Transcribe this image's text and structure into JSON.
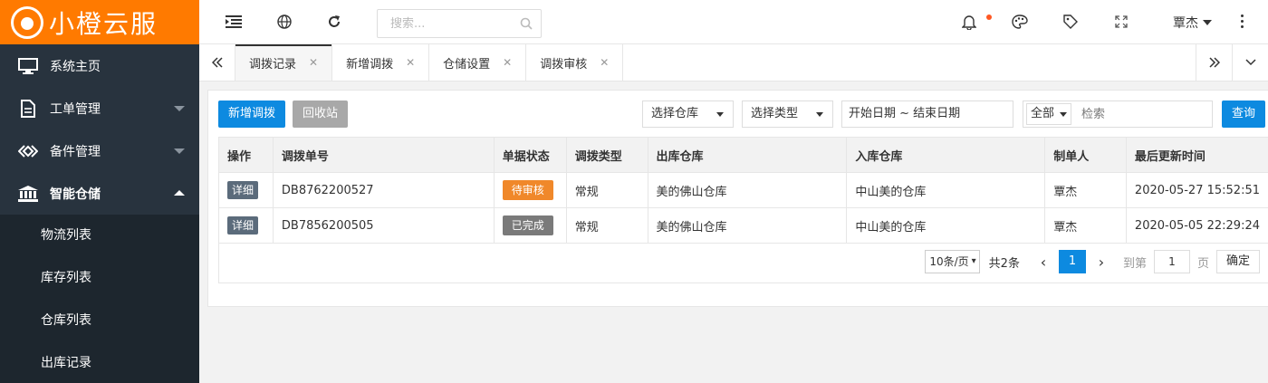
{
  "app": {
    "logo_text": "小橙云服"
  },
  "sidebar": {
    "items": [
      {
        "label": "系统主页",
        "icon": "monitor-icon"
      },
      {
        "label": "工单管理",
        "icon": "document-icon"
      },
      {
        "label": "备件管理",
        "icon": "diamond-link-icon"
      },
      {
        "label": "智能仓储",
        "icon": "bank-icon"
      }
    ],
    "submenu": [
      "物流列表",
      "库存列表",
      "仓库列表",
      "出库记录"
    ]
  },
  "header": {
    "search_placeholder": "搜索...",
    "user_name": "覃杰"
  },
  "tabs": [
    "调拨记录",
    "新增调拨",
    "仓储设置",
    "调拨审核"
  ],
  "toolbar": {
    "add_button": "新增调拨",
    "recycle_button": "回收站",
    "warehouse_select": "选择仓库",
    "type_select": "选择类型",
    "date_range": "开始日期 ~ 结束日期",
    "scope_select": "全部",
    "keyword_placeholder": "检索",
    "query_button": "查询"
  },
  "table": {
    "headers": [
      "操作",
      "调拨单号",
      "单据状态",
      "调拨类型",
      "出库仓库",
      "入库仓库",
      "制单人",
      "最后更新时间"
    ],
    "rows": [
      {
        "action": "详细",
        "no": "DB8762200527",
        "status": "待审核",
        "status_color": "#f0882a",
        "type": "常规",
        "out": "美的佛山仓库",
        "in": "中山美的仓库",
        "creator": "覃杰",
        "updated": "2020-05-27 15:52:51"
      },
      {
        "action": "详细",
        "no": "DB7856200505",
        "status": "已完成",
        "status_color": "#7a7a7a",
        "type": "常规",
        "out": "美的佛山仓库",
        "in": "中山美的仓库",
        "creator": "覃杰",
        "updated": "2020-05-05 22:29:24"
      }
    ]
  },
  "pagination": {
    "page_size": "10条/页",
    "total": "共2条",
    "current": "1",
    "goto_label": "到第",
    "goto_value": "1",
    "unit": "页",
    "confirm": "确定"
  },
  "colors": {
    "brand": "#ff7a00",
    "sidebar": "#28333e",
    "primary": "#0d8ae0"
  }
}
